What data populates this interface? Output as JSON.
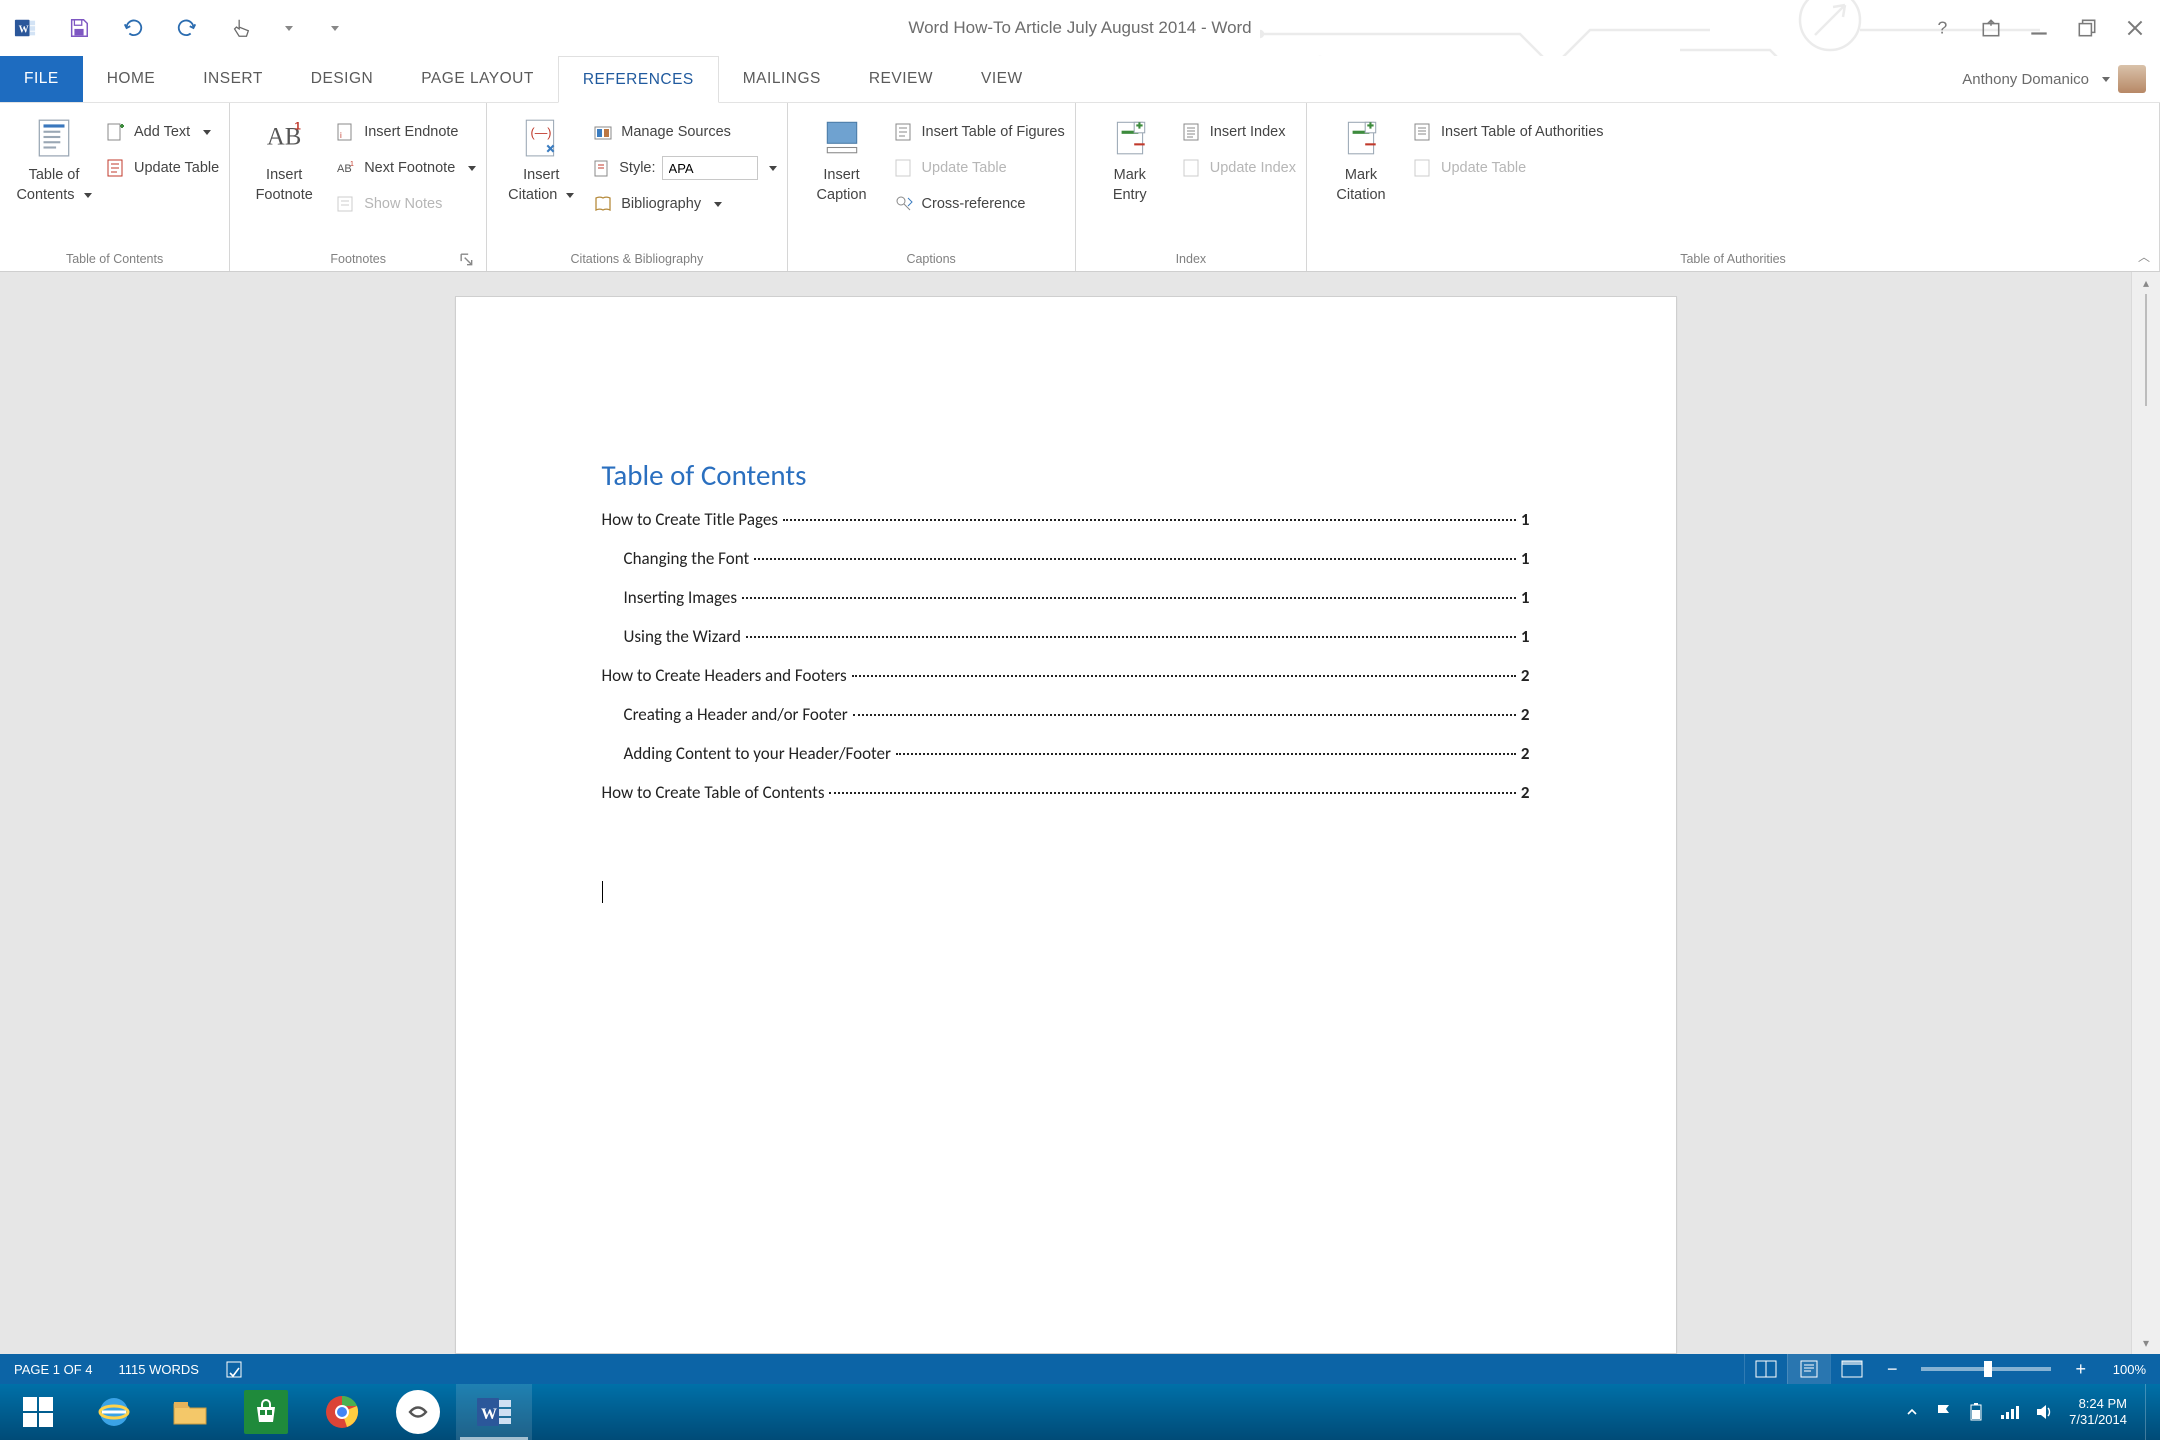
{
  "title": "Word How-To Article July August 2014 - Word",
  "user_name": "Anthony Domanico",
  "tabs": {
    "file": "FILE",
    "home": "HOME",
    "insert": "INSERT",
    "design": "DESIGN",
    "page_layout": "PAGE LAYOUT",
    "references": "REFERENCES",
    "mailings": "MAILINGS",
    "review": "REVIEW",
    "view": "VIEW"
  },
  "ribbon": {
    "toc": {
      "big": "Table of\nContents",
      "add_text": "Add Text",
      "update": "Update Table",
      "group": "Table of Contents"
    },
    "footnotes": {
      "big": "Insert\nFootnote",
      "endnote": "Insert Endnote",
      "next": "Next Footnote",
      "show": "Show Notes",
      "group": "Footnotes"
    },
    "citations": {
      "big": "Insert\nCitation",
      "manage": "Manage Sources",
      "style_label": "Style:",
      "style_value": "APA",
      "biblio": "Bibliography",
      "group": "Citations & Bibliography"
    },
    "captions": {
      "big": "Insert\nCaption",
      "toc_fig": "Insert Table of Figures",
      "update": "Update Table",
      "cross": "Cross-reference",
      "group": "Captions"
    },
    "index": {
      "big": "Mark\nEntry",
      "insert": "Insert Index",
      "update": "Update Index",
      "group": "Index"
    },
    "authorities": {
      "big": "Mark\nCitation",
      "insert": "Insert Table of Authorities",
      "update": "Update Table",
      "group": "Table of Authorities"
    }
  },
  "document": {
    "toc_title": "Table of Contents",
    "lines": [
      {
        "text": "How to Create Title Pages",
        "page": "1",
        "indent": 0
      },
      {
        "text": "Changing the Font",
        "page": "1",
        "indent": 1
      },
      {
        "text": "Inserting Images",
        "page": "1",
        "indent": 1
      },
      {
        "text": "Using the Wizard",
        "page": "1",
        "indent": 1
      },
      {
        "text": "How to Create Headers and Footers",
        "page": "2",
        "indent": 0
      },
      {
        "text": "Creating a Header and/or Footer",
        "page": "2",
        "indent": 1
      },
      {
        "text": "Adding Content to your Header/Footer",
        "page": "2",
        "indent": 1
      },
      {
        "text": "How to Create Table of Contents",
        "page": "2",
        "indent": 0
      }
    ]
  },
  "statusbar": {
    "page": "PAGE 1 OF 4",
    "words": "1115 WORDS",
    "zoom": "100%"
  },
  "tray": {
    "time": "8:24 PM",
    "date": "7/31/2014"
  }
}
